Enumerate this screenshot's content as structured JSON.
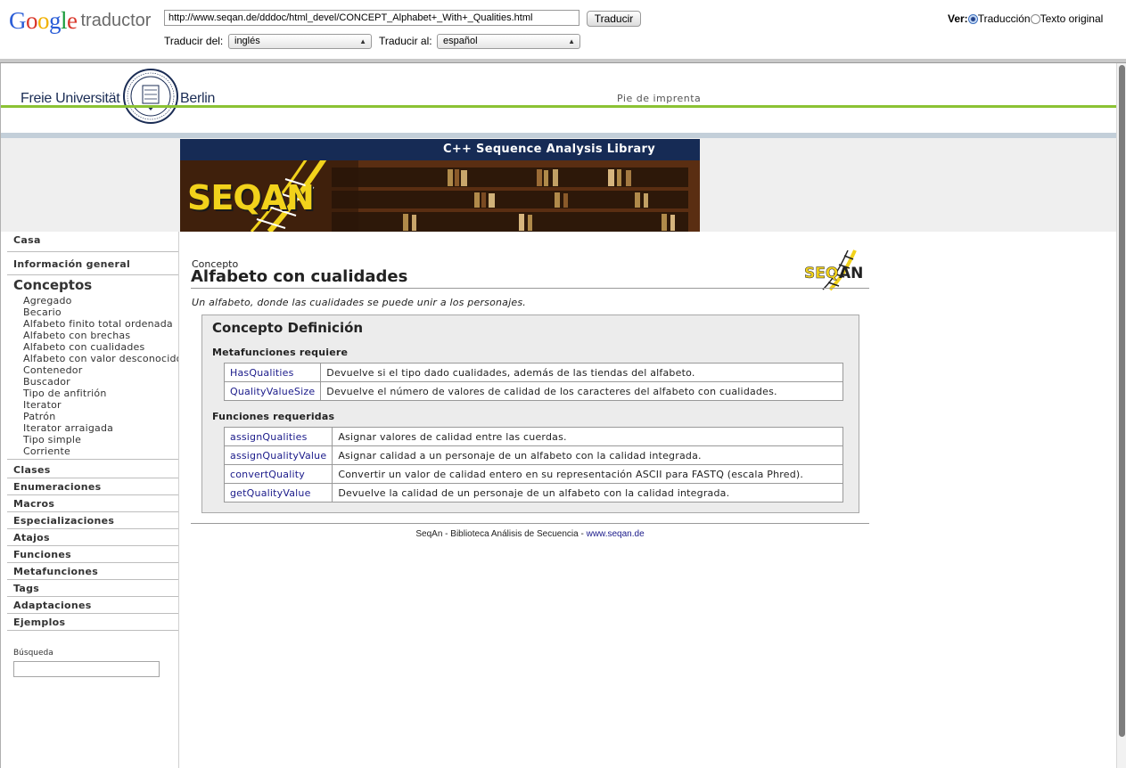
{
  "google": {
    "logo": "Google",
    "product": "traductor",
    "url": "http://www.seqan.de/dddoc/html_devel/CONCEPT_Alphabet+_With+_Qualities.html",
    "translate_button": "Traducir",
    "from_label": "Traducir del:",
    "from_value": "inglés",
    "to_label": "Traducir al:",
    "to_value": "español",
    "view_label": "Ver:",
    "view_translation": "Traducción",
    "view_original": "Texto original"
  },
  "fu": {
    "name": "Freie Universität",
    "city": "Berlin",
    "imprint": "Pie de imprenta"
  },
  "banner": {
    "title": "C++ Sequence Analysis Library",
    "logo": "SEQAN"
  },
  "sidebar": {
    "home": "Casa",
    "overview": "Información general",
    "concepts": "Conceptos",
    "concept_items": [
      "Agregado",
      "Becario",
      "Alfabeto finito total ordenada",
      "Alfabeto con brechas",
      "Alfabeto con cualidades",
      "Alfabeto con valor desconocido",
      "Contenedor",
      "Buscador",
      "Tipo de anfitrión",
      "Iterator",
      "Patrón",
      "Iterator arraigada",
      "Tipo simple",
      "Corriente"
    ],
    "sections": [
      "Clases",
      "Enumeraciones",
      "Macros",
      "Especializaciones",
      "Atajos",
      "Funciones",
      "Metafunciones",
      "Tags",
      "Adaptaciones",
      "Ejemplos"
    ],
    "search_label": "Búsqueda"
  },
  "main": {
    "kicker": "Concepto",
    "title": "Alfabeto con cualidades",
    "description": "Un alfabeto, donde las cualidades se puede unir a los personajes.",
    "definition_title": "Concepto Definición",
    "metafunctions_title": "Metafunciones requiere",
    "metafunctions": [
      {
        "name": "HasQualities",
        "desc": "Devuelve si el tipo dado cualidades, además de las tiendas del alfabeto."
      },
      {
        "name": "QualityValueSize",
        "desc": "Devuelve el número de valores de calidad de los caracteres del alfabeto con cualidades."
      }
    ],
    "functions_title": "Funciones requeridas",
    "functions": [
      {
        "name": "assignQualities",
        "desc": "Asignar valores de calidad entre las cuerdas."
      },
      {
        "name": "assignQualityValue",
        "desc": "Asignar calidad a un personaje de un alfabeto con la calidad integrada."
      },
      {
        "name": "convertQuality",
        "desc": "Convertir un valor de calidad entero en su representación ASCII para FASTQ (escala Phred)."
      },
      {
        "name": "getQualityValue",
        "desc": "Devuelve la calidad de un personaje de un alfabeto con la calidad integrada."
      }
    ]
  },
  "footer": {
    "text": "SeqAn - Biblioteca Análisis de Secuencia - ",
    "link": "www.seqan.de"
  }
}
